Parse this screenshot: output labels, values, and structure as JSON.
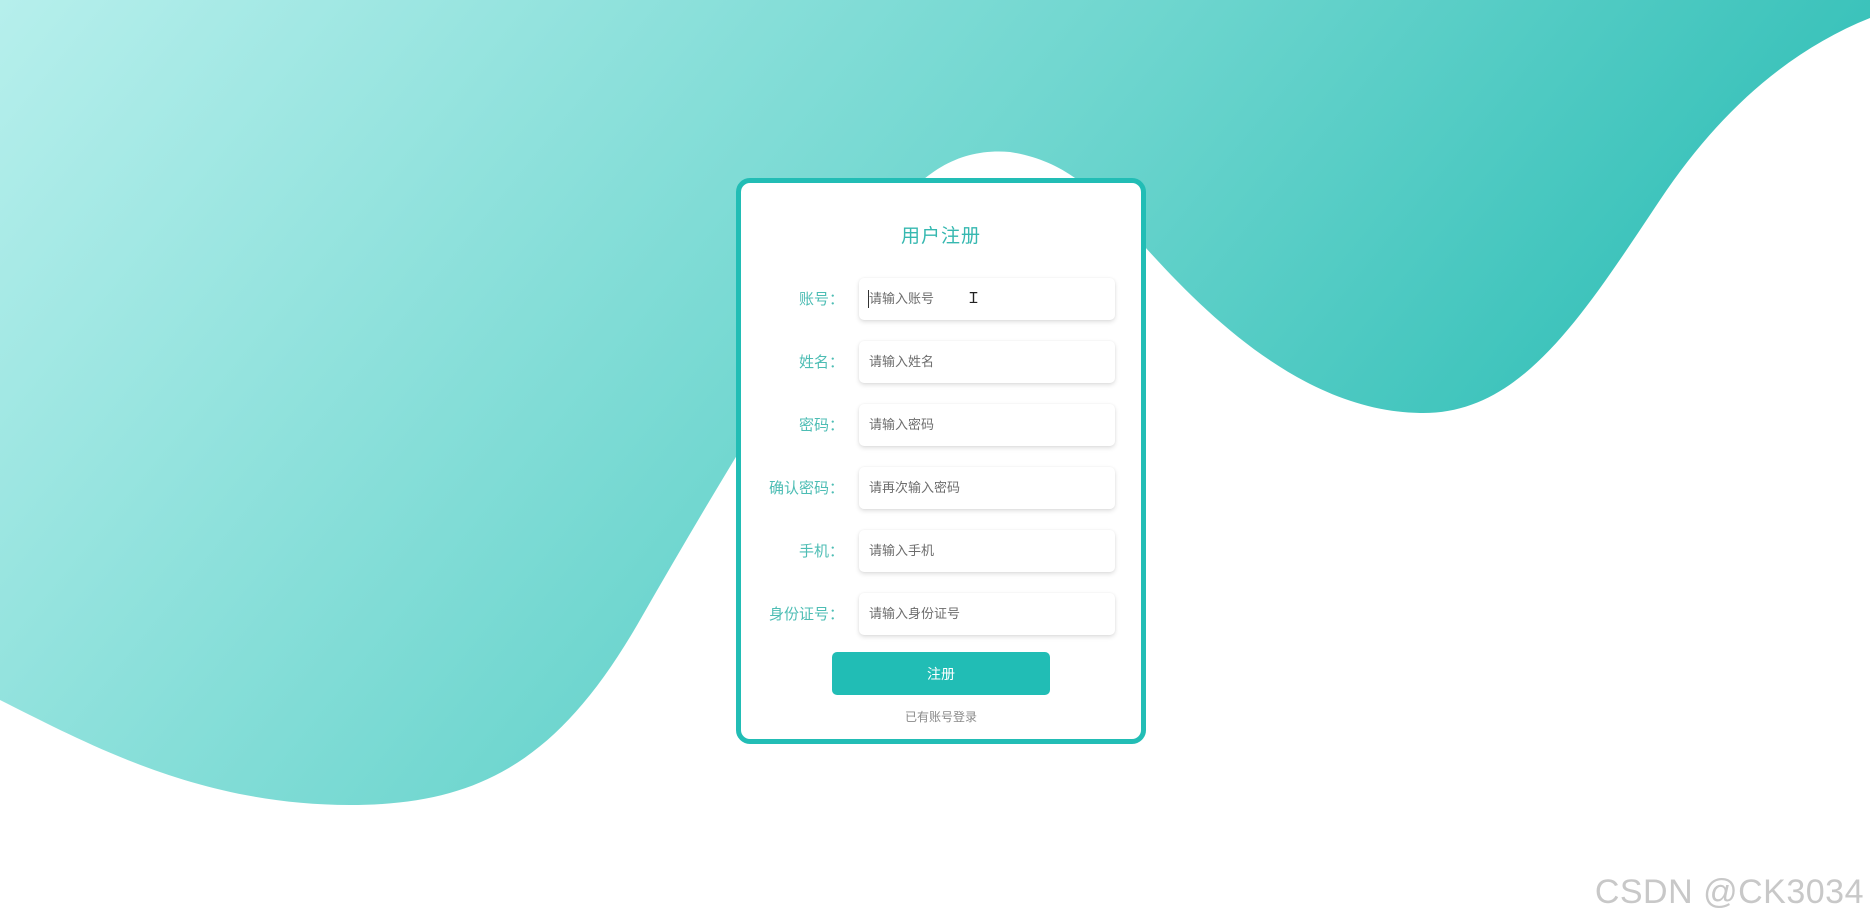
{
  "page": {
    "title": "用户注册"
  },
  "form": {
    "fields": [
      {
        "label": "账号：",
        "placeholder": "请输入账号"
      },
      {
        "label": "姓名：",
        "placeholder": "请输入姓名"
      },
      {
        "label": "密码：",
        "placeholder": "请输入密码"
      },
      {
        "label": "确认密码：",
        "placeholder": "请再次输入密码"
      },
      {
        "label": "手机：",
        "placeholder": "请输入手机"
      },
      {
        "label": "身份证号：",
        "placeholder": "请输入身份证号"
      }
    ],
    "submit_label": "注册",
    "login_link": "已有账号登录"
  },
  "watermark": "CSDN @CK3034",
  "colors": {
    "accent": "#21bdb5",
    "label": "#4dbdb4",
    "wave_light": "#b6efec",
    "wave_dark": "#2cbdb5"
  },
  "icons": {
    "text_cursor": "i-beam-cursor-icon"
  }
}
